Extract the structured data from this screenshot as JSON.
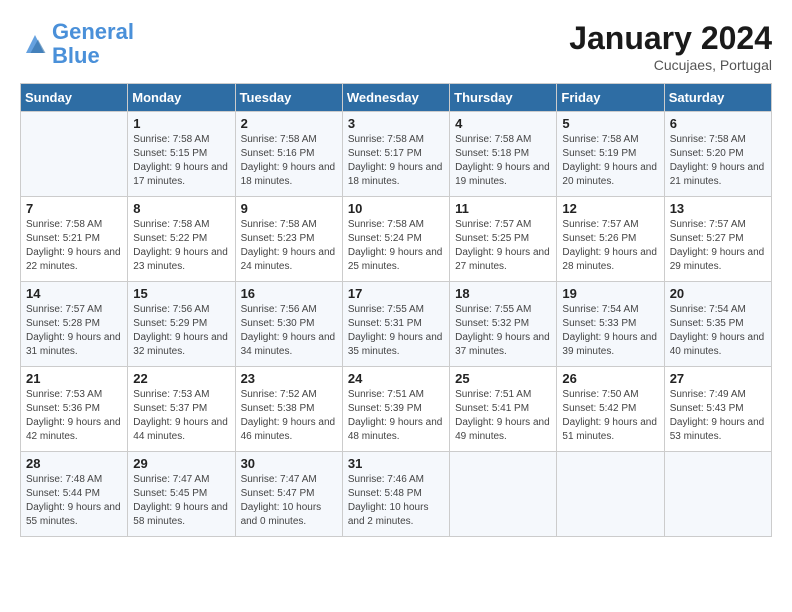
{
  "logo": {
    "line1": "General",
    "line2": "Blue"
  },
  "title": "January 2024",
  "subtitle": "Cucujaes, Portugal",
  "days_of_week": [
    "Sunday",
    "Monday",
    "Tuesday",
    "Wednesday",
    "Thursday",
    "Friday",
    "Saturday"
  ],
  "weeks": [
    [
      {
        "day": "",
        "sunrise": "",
        "sunset": "",
        "daylight": ""
      },
      {
        "day": "1",
        "sunrise": "Sunrise: 7:58 AM",
        "sunset": "Sunset: 5:15 PM",
        "daylight": "Daylight: 9 hours and 17 minutes."
      },
      {
        "day": "2",
        "sunrise": "Sunrise: 7:58 AM",
        "sunset": "Sunset: 5:16 PM",
        "daylight": "Daylight: 9 hours and 18 minutes."
      },
      {
        "day": "3",
        "sunrise": "Sunrise: 7:58 AM",
        "sunset": "Sunset: 5:17 PM",
        "daylight": "Daylight: 9 hours and 18 minutes."
      },
      {
        "day": "4",
        "sunrise": "Sunrise: 7:58 AM",
        "sunset": "Sunset: 5:18 PM",
        "daylight": "Daylight: 9 hours and 19 minutes."
      },
      {
        "day": "5",
        "sunrise": "Sunrise: 7:58 AM",
        "sunset": "Sunset: 5:19 PM",
        "daylight": "Daylight: 9 hours and 20 minutes."
      },
      {
        "day": "6",
        "sunrise": "Sunrise: 7:58 AM",
        "sunset": "Sunset: 5:20 PM",
        "daylight": "Daylight: 9 hours and 21 minutes."
      }
    ],
    [
      {
        "day": "7",
        "sunrise": "Sunrise: 7:58 AM",
        "sunset": "Sunset: 5:21 PM",
        "daylight": "Daylight: 9 hours and 22 minutes."
      },
      {
        "day": "8",
        "sunrise": "Sunrise: 7:58 AM",
        "sunset": "Sunset: 5:22 PM",
        "daylight": "Daylight: 9 hours and 23 minutes."
      },
      {
        "day": "9",
        "sunrise": "Sunrise: 7:58 AM",
        "sunset": "Sunset: 5:23 PM",
        "daylight": "Daylight: 9 hours and 24 minutes."
      },
      {
        "day": "10",
        "sunrise": "Sunrise: 7:58 AM",
        "sunset": "Sunset: 5:24 PM",
        "daylight": "Daylight: 9 hours and 25 minutes."
      },
      {
        "day": "11",
        "sunrise": "Sunrise: 7:57 AM",
        "sunset": "Sunset: 5:25 PM",
        "daylight": "Daylight: 9 hours and 27 minutes."
      },
      {
        "day": "12",
        "sunrise": "Sunrise: 7:57 AM",
        "sunset": "Sunset: 5:26 PM",
        "daylight": "Daylight: 9 hours and 28 minutes."
      },
      {
        "day": "13",
        "sunrise": "Sunrise: 7:57 AM",
        "sunset": "Sunset: 5:27 PM",
        "daylight": "Daylight: 9 hours and 29 minutes."
      }
    ],
    [
      {
        "day": "14",
        "sunrise": "Sunrise: 7:57 AM",
        "sunset": "Sunset: 5:28 PM",
        "daylight": "Daylight: 9 hours and 31 minutes."
      },
      {
        "day": "15",
        "sunrise": "Sunrise: 7:56 AM",
        "sunset": "Sunset: 5:29 PM",
        "daylight": "Daylight: 9 hours and 32 minutes."
      },
      {
        "day": "16",
        "sunrise": "Sunrise: 7:56 AM",
        "sunset": "Sunset: 5:30 PM",
        "daylight": "Daylight: 9 hours and 34 minutes."
      },
      {
        "day": "17",
        "sunrise": "Sunrise: 7:55 AM",
        "sunset": "Sunset: 5:31 PM",
        "daylight": "Daylight: 9 hours and 35 minutes."
      },
      {
        "day": "18",
        "sunrise": "Sunrise: 7:55 AM",
        "sunset": "Sunset: 5:32 PM",
        "daylight": "Daylight: 9 hours and 37 minutes."
      },
      {
        "day": "19",
        "sunrise": "Sunrise: 7:54 AM",
        "sunset": "Sunset: 5:33 PM",
        "daylight": "Daylight: 9 hours and 39 minutes."
      },
      {
        "day": "20",
        "sunrise": "Sunrise: 7:54 AM",
        "sunset": "Sunset: 5:35 PM",
        "daylight": "Daylight: 9 hours and 40 minutes."
      }
    ],
    [
      {
        "day": "21",
        "sunrise": "Sunrise: 7:53 AM",
        "sunset": "Sunset: 5:36 PM",
        "daylight": "Daylight: 9 hours and 42 minutes."
      },
      {
        "day": "22",
        "sunrise": "Sunrise: 7:53 AM",
        "sunset": "Sunset: 5:37 PM",
        "daylight": "Daylight: 9 hours and 44 minutes."
      },
      {
        "day": "23",
        "sunrise": "Sunrise: 7:52 AM",
        "sunset": "Sunset: 5:38 PM",
        "daylight": "Daylight: 9 hours and 46 minutes."
      },
      {
        "day": "24",
        "sunrise": "Sunrise: 7:51 AM",
        "sunset": "Sunset: 5:39 PM",
        "daylight": "Daylight: 9 hours and 48 minutes."
      },
      {
        "day": "25",
        "sunrise": "Sunrise: 7:51 AM",
        "sunset": "Sunset: 5:41 PM",
        "daylight": "Daylight: 9 hours and 49 minutes."
      },
      {
        "day": "26",
        "sunrise": "Sunrise: 7:50 AM",
        "sunset": "Sunset: 5:42 PM",
        "daylight": "Daylight: 9 hours and 51 minutes."
      },
      {
        "day": "27",
        "sunrise": "Sunrise: 7:49 AM",
        "sunset": "Sunset: 5:43 PM",
        "daylight": "Daylight: 9 hours and 53 minutes."
      }
    ],
    [
      {
        "day": "28",
        "sunrise": "Sunrise: 7:48 AM",
        "sunset": "Sunset: 5:44 PM",
        "daylight": "Daylight: 9 hours and 55 minutes."
      },
      {
        "day": "29",
        "sunrise": "Sunrise: 7:47 AM",
        "sunset": "Sunset: 5:45 PM",
        "daylight": "Daylight: 9 hours and 58 minutes."
      },
      {
        "day": "30",
        "sunrise": "Sunrise: 7:47 AM",
        "sunset": "Sunset: 5:47 PM",
        "daylight": "Daylight: 10 hours and 0 minutes."
      },
      {
        "day": "31",
        "sunrise": "Sunrise: 7:46 AM",
        "sunset": "Sunset: 5:48 PM",
        "daylight": "Daylight: 10 hours and 2 minutes."
      },
      {
        "day": "",
        "sunrise": "",
        "sunset": "",
        "daylight": ""
      },
      {
        "day": "",
        "sunrise": "",
        "sunset": "",
        "daylight": ""
      },
      {
        "day": "",
        "sunrise": "",
        "sunset": "",
        "daylight": ""
      }
    ]
  ]
}
